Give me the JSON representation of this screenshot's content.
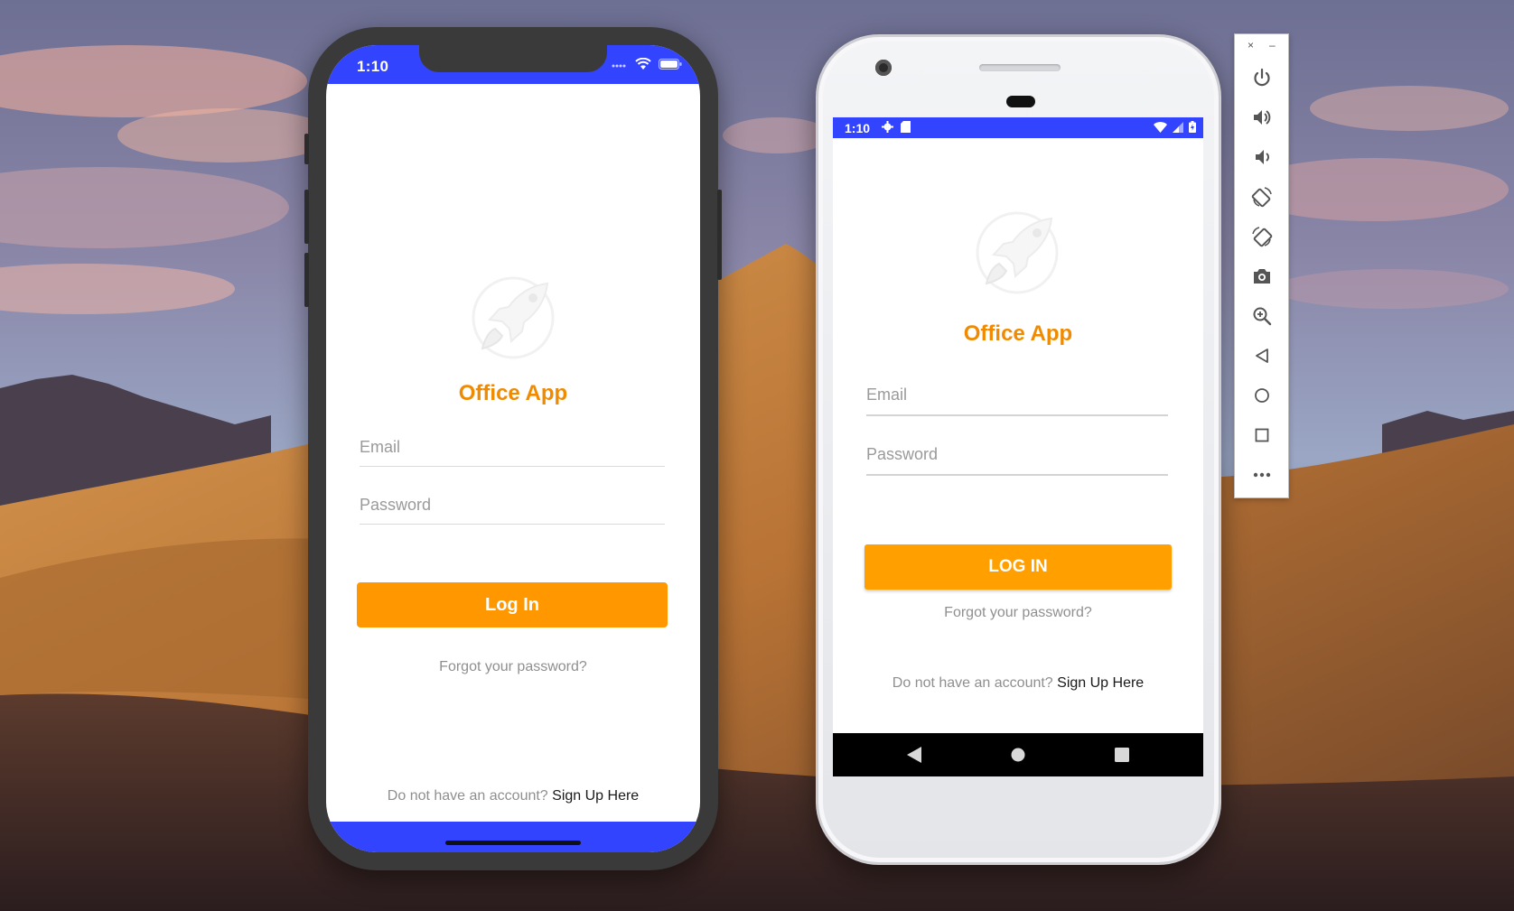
{
  "colors": {
    "status_bar": "#3344ff",
    "accent": "#ff9800",
    "title": "#f08a00"
  },
  "iphone": {
    "status": {
      "time": "1:10"
    },
    "app": {
      "title": "Office App",
      "email_placeholder": "Email",
      "password_placeholder": "Password",
      "login_label": "Log In",
      "forgot_label": "Forgot your password?",
      "signup_prompt": "Do not have an account?",
      "signup_link": "Sign Up Here"
    }
  },
  "android": {
    "status": {
      "time": "1:10"
    },
    "app": {
      "title": "Office App",
      "email_placeholder": "Email",
      "password_placeholder": "Password",
      "login_label": "LOG IN",
      "forgot_label": "Forgot your password?",
      "signup_prompt": "Do not have an account?",
      "signup_link": "Sign Up Here"
    },
    "navbar": [
      "back-icon",
      "home-icon",
      "recents-icon"
    ]
  },
  "emulator_toolbar": {
    "close_label": "×",
    "minimize_label": "–",
    "buttons": [
      "power-icon",
      "volume-up-icon",
      "volume-down-icon",
      "rotate-left-icon",
      "rotate-right-icon",
      "camera-icon",
      "zoom-icon",
      "back-icon",
      "home-icon",
      "overview-icon",
      "more-icon"
    ]
  }
}
